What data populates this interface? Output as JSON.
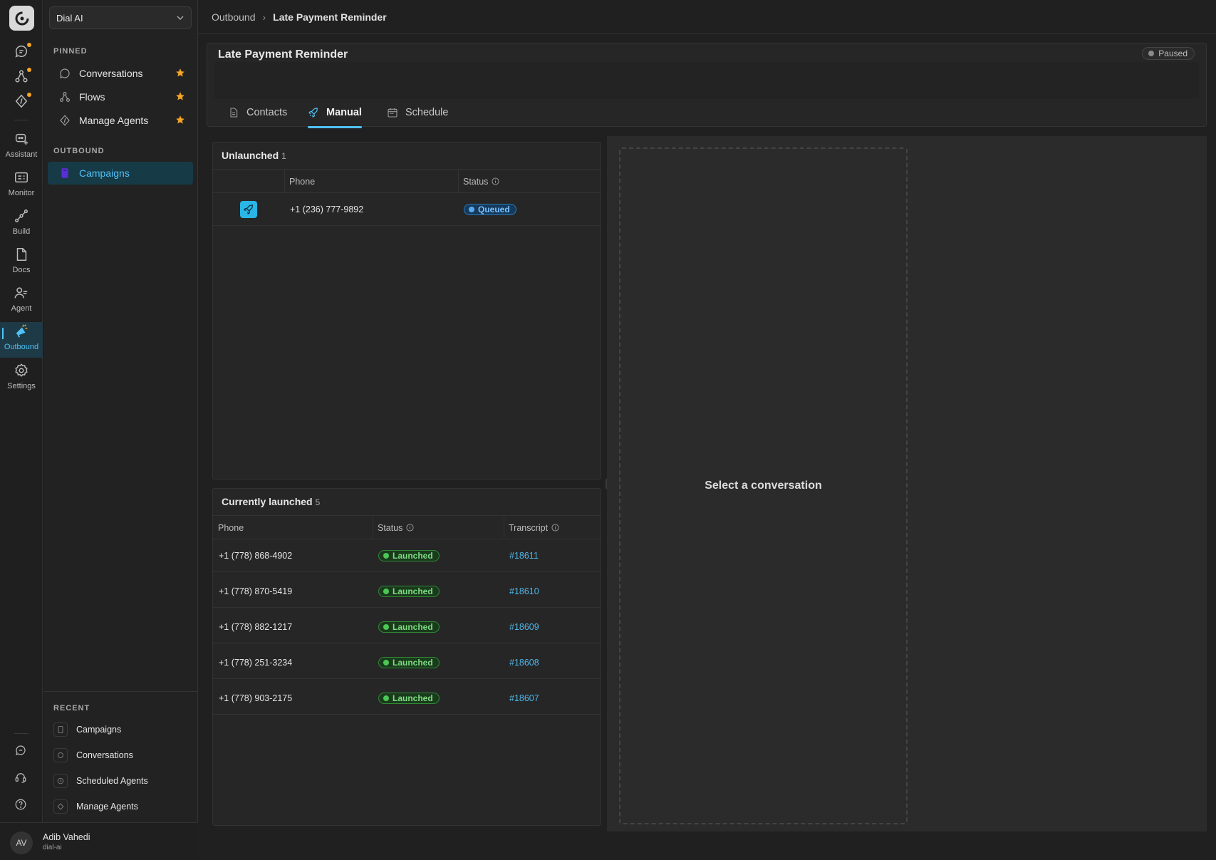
{
  "app": {
    "workspace": "Dial AI"
  },
  "rail": {
    "items": [
      {
        "label": "Assistant"
      },
      {
        "label": "Monitor"
      },
      {
        "label": "Build"
      },
      {
        "label": "Docs"
      },
      {
        "label": "Agent"
      },
      {
        "label": "Outbound"
      },
      {
        "label": "Settings"
      }
    ],
    "active": "Outbound",
    "accent": "#4fc3f7",
    "notify_color": "#f5a524"
  },
  "sidebar": {
    "pinned_heading": "PINNED",
    "pinned": [
      {
        "label": "Conversations",
        "icon": "chat-bubble-icon",
        "starred": true
      },
      {
        "label": "Flows",
        "icon": "flow-icon",
        "starred": true
      },
      {
        "label": "Manage Agents",
        "icon": "agents-code-icon",
        "starred": true
      }
    ],
    "outbound_heading": "OUTBOUND",
    "outbound": [
      {
        "label": "Campaigns",
        "icon": "campaign-icon",
        "active": true
      }
    ],
    "recent_heading": "RECENT",
    "recent": [
      {
        "label": "Campaigns"
      },
      {
        "label": "Conversations"
      },
      {
        "label": "Scheduled Agents"
      },
      {
        "label": "Manage Agents"
      }
    ],
    "user": {
      "initials": "AV",
      "name": "Adib Vahedi",
      "org": "dial-ai"
    }
  },
  "breadcrumb": {
    "parent": "Outbound",
    "current": "Late Payment Reminder"
  },
  "campaign": {
    "title": "Late Payment Reminder",
    "status": "Paused",
    "tabs": [
      {
        "label": "Contacts",
        "icon": "document-icon"
      },
      {
        "label": "Manual",
        "icon": "rocket-icon",
        "active": true
      },
      {
        "label": "Schedule",
        "icon": "calendar-icon"
      }
    ]
  },
  "unlaunched": {
    "title": "Unlaunched",
    "count": "1",
    "columns": [
      "Phone",
      "Status"
    ],
    "rows": [
      {
        "phone": "+1 (236) 777-9892",
        "status": "Queued"
      }
    ]
  },
  "launched": {
    "title": "Currently launched",
    "count": "5",
    "columns": [
      "Phone",
      "Status",
      "Transcript"
    ],
    "rows": [
      {
        "phone": "+1 (778) 868-4902",
        "status": "Launched",
        "transcript": "#18611"
      },
      {
        "phone": "+1 (778) 870-5419",
        "status": "Launched",
        "transcript": "#18610"
      },
      {
        "phone": "+1 (778) 882-1217",
        "status": "Launched",
        "transcript": "#18609"
      },
      {
        "phone": "+1 (778) 251-3234",
        "status": "Launched",
        "transcript": "#18608"
      },
      {
        "phone": "+1 (778) 903-2175",
        "status": "Launched",
        "transcript": "#18607"
      }
    ]
  },
  "detail": {
    "empty_text": "Select a conversation"
  },
  "colors": {
    "queued": "#2e78b6",
    "launched": "#2f8a36",
    "link": "#4fb6e8"
  }
}
